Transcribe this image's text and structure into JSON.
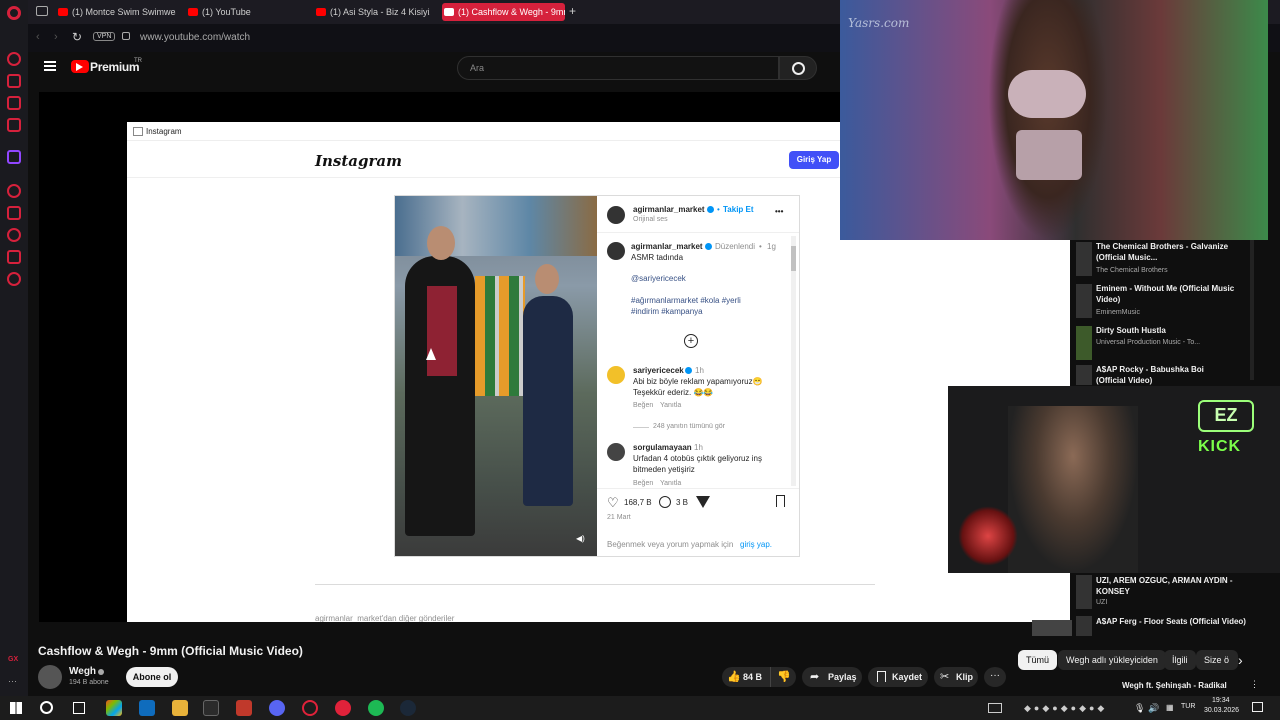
{
  "browser": {
    "tabs": [
      {
        "label": "(1) Montce Swim Swimwea"
      },
      {
        "label": "(1) YouTube"
      },
      {
        "label": "(1) Asi Styla - Biz 4 Kisiyiz"
      },
      {
        "label": "(1) Cashflow & Wegh - 9mm"
      }
    ],
    "vpn_badge": "VPN",
    "url": "www.youtube.com/watch"
  },
  "youtube": {
    "logo_text": "Premium",
    "logo_sup": "TR",
    "search_placeholder": "Ara"
  },
  "instagram": {
    "window_title": "Instagram",
    "logo": "Instagram",
    "login_button": "Giriş Yap",
    "post_author": "agirmanlar_market",
    "follow": "Takip Et",
    "audio": "Orijinal ses",
    "more": "•••",
    "caption_author": "agirmanlar_market",
    "edited": "Düzenlendi",
    "edited_time": "1g",
    "caption_line1": "ASMR tadında",
    "mention": "@sariyericecek",
    "hashtags1": "#ağırmanlarmarket #kola #yerli",
    "hashtags2": "#indirim #kampanya",
    "comments": [
      {
        "author": "sariyericecek",
        "time": "1h",
        "line1": "Abi biz böyle reklam yapamıyoruz😁",
        "line2": "Teşekkür ederiz. 😂😂",
        "like": "Beğen",
        "reply": "Yanıtla"
      },
      {
        "author": "sorgulamayaan",
        "time": "1h",
        "line1": "Urfadan 4 otobüs çıktık geliyoruz inş",
        "line2": "bitmeden yetişiriz",
        "like": "Beğen",
        "reply": "Yanıtla"
      }
    ],
    "view_replies": "248 yanıtın tümünü gör",
    "likes": "168,7 B",
    "comments_count": "3 B",
    "date": "21 Mart",
    "login_prompt": "Beğenmek veya yorum yapmak için",
    "login_link": "giriş yap.",
    "more_posts": "agirmanlar_market'dan diğer gönderiler"
  },
  "recommendations": [
    {
      "time": "4:44",
      "title": "The Chemical Brothers - Galvanize (Official Music...",
      "channel": "The Chemical Brothers"
    },
    {
      "time": "4:58",
      "title": "Eminem - Without Me (Official Music Video)",
      "channel": "EminemMusic"
    },
    {
      "time": "3:52",
      "title": "Dirty South Hustla",
      "channel": "Universal Production Music - To..."
    },
    {
      "time": "",
      "title": "A$AP Rocky - Babushka Boi (Official Video)",
      "channel": ""
    },
    {
      "time": "3:13",
      "title": "UZI, AREM OZGUC, ARMAN AYDIN - KONSEY",
      "channel": "UZI"
    },
    {
      "time": "",
      "title": "A$AP Ferg - Floor Seats (Official Video)",
      "channel": ""
    }
  ],
  "overlay_fashion": {
    "watermark": "Yasrs.com"
  },
  "overlay_cam": {
    "badge_top": "EZ",
    "badge_bottom": "KICK"
  },
  "video": {
    "title": "Cashflow & Wegh - 9mm (Official Music Video)",
    "channel": "Wegh",
    "subscribers": "194 B abone",
    "subscribe": "Abone ol",
    "likes": "84 B",
    "share": "Paylaş",
    "save": "Kaydet",
    "clip": "Klip"
  },
  "filter_chips": [
    "Tümü",
    "Wegh adlı yükleyiciden",
    "İlgili",
    "Size ö"
  ],
  "next_title": "Wegh ft. Şehinşah - Radikal",
  "taskbar": {
    "lang": "TUR",
    "time": "19:34",
    "date": "30.03.2026"
  },
  "colors": {
    "accent": "#d6213c",
    "youtube_red": "#ff0000",
    "ig_blue": "#0095f6"
  }
}
